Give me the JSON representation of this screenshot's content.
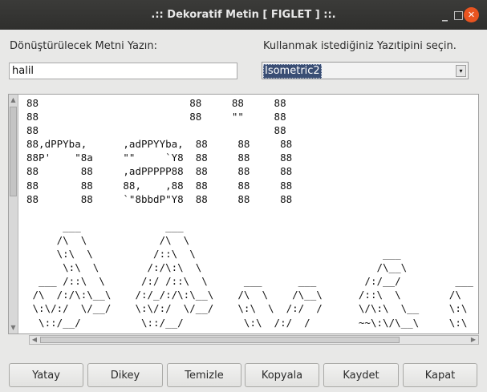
{
  "window": {
    "title": ".:: Dekoratif Metin [ FIGLET ] ::.",
    "minimize_glyph": "_",
    "maximize_glyph": "□",
    "close_glyph": "✕"
  },
  "form": {
    "input_label": "Dönüştürülecek Metni Yazın:",
    "input_value": "halil",
    "font_label": "Kullanmak istediğiniz Yazıtipini seçin.",
    "font_selected": "Isometric2"
  },
  "output": {
    "lines": [
      "88                         88     88     88",
      "88                         88     \"\"     88",
      "88                                       88",
      "88,dPPYba,      ,adPPYYba,  88     88     88",
      "88P'    \"8a     \"\"     `Y8  88     88     88",
      "88       88     ,adPPPPP88  88     88     88",
      "88       88     88,    ,88  88     88     88",
      "88       88     `\"8bbdP\"Y8  88     88     88",
      "",
      "      ___              ___",
      "     /\\  \\            /\\  \\",
      "     \\:\\  \\          /::\\  \\                               ___",
      "      \\:\\  \\        /:/\\:\\  \\                             /\\__\\",
      "  ___ /::\\  \\      /:/ /::\\  \\      ___      ___        /:/__/         ___",
      " /\\  /:/\\:\\__\\    /:/_/:/\\:\\__\\    /\\  \\    /\\__\\      /::\\  \\        /\\",
      " \\:\\/:/  \\/__/    \\:\\/:/  \\/__/    \\:\\  \\  /:/  /      \\/\\:\\  \\__     \\:\\",
      "  \\::/__/          \\::/__/          \\:\\  /:/  /        ~~\\:\\/\\__\\     \\:\\",
      "   \\:\\  \\           \\:\\  \\           \\:\\/:/  /            \\::/  /      \\:\\"
    ]
  },
  "buttons": {
    "yatay": "Yatay",
    "dikey": "Dikey",
    "temizle": "Temizle",
    "kopyala": "Kopyala",
    "kaydet": "Kaydet",
    "kapat": "Kapat"
  },
  "icons": {
    "combo_arrow": "▾",
    "scroll_up": "▲",
    "scroll_down": "▼",
    "scroll_left": "◀",
    "scroll_right": "▶"
  },
  "colors": {
    "titlebar": "#2f2f2d",
    "close_button": "#e95420",
    "selection": "#3a4e74"
  }
}
